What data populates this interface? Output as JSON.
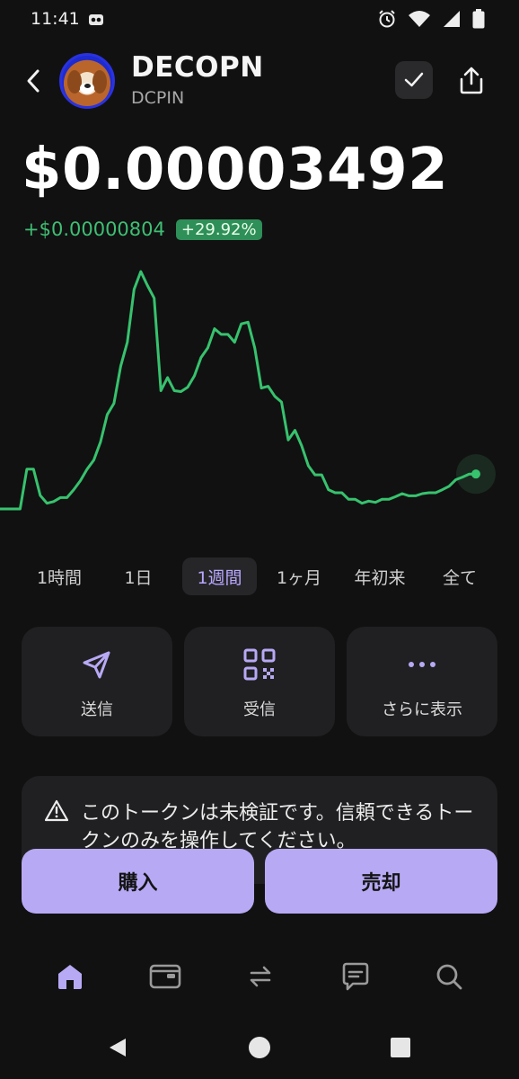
{
  "status_bar": {
    "time": "11:41"
  },
  "header": {
    "token_name": "DECOPN",
    "token_symbol": "DCPIN"
  },
  "price": {
    "value": "$0.00003492",
    "change_abs": "+$0.00000804",
    "change_pct": "+29.92%"
  },
  "chart_data": {
    "type": "line",
    "x": [
      0,
      1,
      2,
      3,
      4,
      5,
      6,
      7,
      8,
      9,
      10,
      11,
      12,
      13,
      14,
      15,
      16,
      17,
      18,
      19,
      20,
      21,
      22,
      23,
      24,
      25,
      26,
      27,
      28,
      29,
      30,
      31,
      32,
      33,
      34,
      35,
      36,
      37,
      38,
      39,
      40,
      41,
      42,
      43,
      44,
      45,
      46,
      47,
      48,
      49,
      50,
      51,
      52,
      53,
      54,
      55,
      56,
      57,
      58,
      59,
      60,
      61,
      62,
      63,
      64,
      65,
      66,
      67,
      68,
      69,
      70,
      71,
      72,
      73,
      74,
      75,
      76,
      77,
      78,
      79,
      80,
      81,
      82,
      83,
      84,
      85,
      86,
      87,
      88,
      89,
      90,
      91,
      92,
      93,
      94,
      95,
      96,
      97,
      98,
      99,
      100
    ],
    "series": [
      {
        "color": "#37c26e",
        "values": [
          2.69,
          2.69,
          2.69,
          2.69,
          3.6,
          3.6,
          3.0,
          2.82,
          2.86,
          2.95,
          2.95,
          3.13,
          3.34,
          3.6,
          3.81,
          4.23,
          4.85,
          5.11,
          5.96,
          6.51,
          7.72,
          8.13,
          7.81,
          7.52,
          5.4,
          5.7,
          5.4,
          5.38,
          5.48,
          5.74,
          6.16,
          6.38,
          6.82,
          6.69,
          6.69,
          6.51,
          6.93,
          6.97,
          6.38,
          5.46,
          5.5,
          5.27,
          5.14,
          4.27,
          4.49,
          4.14,
          3.68,
          3.47,
          3.47,
          3.13,
          3.06,
          3.06,
          2.91,
          2.91,
          2.82,
          2.87,
          2.84,
          2.91,
          2.91,
          2.97,
          3.04,
          2.99,
          2.99,
          3.04,
          3.06,
          3.06,
          3.13,
          3.21,
          3.36,
          3.42,
          3.49,
          3.49
        ]
      }
    ],
    "grid": false,
    "legend": "none"
  },
  "ranges": [
    {
      "label": "1時間"
    },
    {
      "label": "1日"
    },
    {
      "label": "1週間"
    },
    {
      "label": "1ヶ月"
    },
    {
      "label": "年初来"
    },
    {
      "label": "全て"
    }
  ],
  "active_range": "1週間",
  "actions": {
    "send": "送信",
    "receive": "受信",
    "more": "さらに表示"
  },
  "warning": {
    "text": "このトークンは未検証です。信頼できるトークンのみを操作してください。"
  },
  "trade": {
    "buy": "購入",
    "sell": "売却"
  },
  "colors": {
    "accent": "#b8a9f5",
    "positive": "#37c26e",
    "background": "#111111",
    "card": "#202022"
  }
}
